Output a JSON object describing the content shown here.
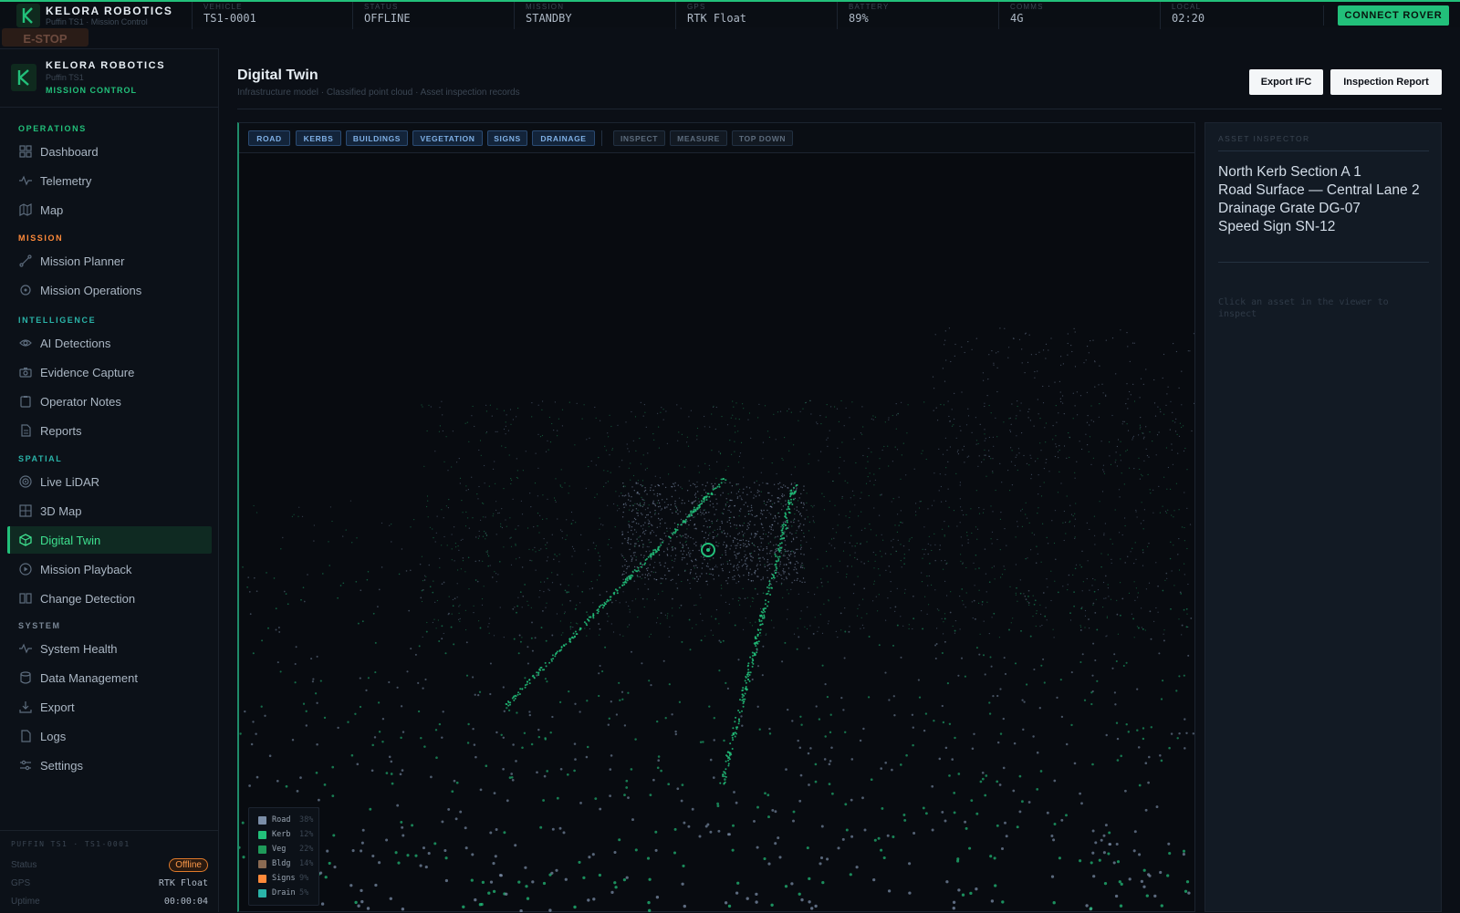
{
  "topbar": {
    "brand_title": "KELORA ROBOTICS",
    "brand_sub": "Puffin TS1 · Mission Control",
    "stats": [
      {
        "label": "VEHICLE",
        "value": "TS1-0001"
      },
      {
        "label": "STATUS",
        "value": "OFFLINE"
      },
      {
        "label": "MISSION",
        "value": "STANDBY"
      },
      {
        "label": "GPS",
        "value": "RTK Float"
      },
      {
        "label": "BATTERY",
        "value": "89%"
      },
      {
        "label": "COMMS",
        "value": "4G"
      },
      {
        "label": "LOCAL",
        "value": "02:20"
      }
    ],
    "connect_label": "CONNECT ROVER",
    "estop_label": "E-STOP"
  },
  "sidebar": {
    "brand_title": "KELORA ROBOTICS",
    "brand_model": "Puffin TS1",
    "brand_tag": "MISSION CONTROL",
    "sections": [
      {
        "label": "OPERATIONS",
        "color": "#22c07a"
      },
      {
        "label": "MISSION",
        "color": "#ff8a3a"
      },
      {
        "label": "INTELLIGENCE",
        "color": "#2ab3a8"
      },
      {
        "label": "SPATIAL",
        "color": "#2ab3a8"
      },
      {
        "label": "SYSTEM",
        "color": "#7a8796"
      }
    ],
    "items": [
      {
        "label": "Dashboard",
        "icon": "grid-icon"
      },
      {
        "label": "Telemetry",
        "icon": "pulse-icon"
      },
      {
        "label": "Map",
        "icon": "map-icon"
      },
      {
        "label": "Mission Planner",
        "icon": "route-icon"
      },
      {
        "label": "Mission Operations",
        "icon": "crosshair-icon"
      },
      {
        "label": "AI Detections",
        "icon": "eye-icon"
      },
      {
        "label": "Evidence Capture",
        "icon": "camera-icon"
      },
      {
        "label": "Operator Notes",
        "icon": "clipboard-icon"
      },
      {
        "label": "Reports",
        "icon": "document-icon"
      },
      {
        "label": "Live LiDAR",
        "icon": "lidar-icon"
      },
      {
        "label": "3D Map",
        "icon": "cube-grid-icon"
      },
      {
        "label": "Digital Twin",
        "icon": "cube-icon"
      },
      {
        "label": "Mission Playback",
        "icon": "play-icon"
      },
      {
        "label": "Change Detection",
        "icon": "compare-icon"
      },
      {
        "label": "System Health",
        "icon": "pulse-icon"
      },
      {
        "label": "Data Management",
        "icon": "database-icon"
      },
      {
        "label": "Export",
        "icon": "download-icon"
      },
      {
        "label": "Logs",
        "icon": "list-icon"
      },
      {
        "label": "Settings",
        "icon": "sliders-icon"
      }
    ],
    "active_item": "Digital Twin",
    "footer": {
      "title": "PUFFIN TS1 · TS1-0001",
      "rows": [
        {
          "key": "Status",
          "value": "Offline"
        },
        {
          "key": "GPS",
          "value": "RTK Float"
        },
        {
          "key": "Uptime",
          "value": "00:00:04"
        }
      ]
    }
  },
  "main": {
    "title": "Digital Twin",
    "subtitle": "Infrastructure model · Classified point cloud · Asset inspection records",
    "export_ifc_label": "Export IFC",
    "inspection_report_label": "Inspection Report"
  },
  "viewer": {
    "layer_chips": [
      "ROAD",
      "KERBS",
      "BUILDINGS",
      "VEGETATION",
      "SIGNS",
      "DRAINAGE"
    ],
    "tool_chips": [
      "INSPECT",
      "MEASURE",
      "TOP DOWN"
    ],
    "legend": [
      {
        "name": "Road",
        "pct": "38%",
        "color": "#7b8ea8"
      },
      {
        "name": "Kerb",
        "pct": "12%",
        "color": "#22c07a"
      },
      {
        "name": "Veg",
        "pct": "22%",
        "color": "#1f9a5a"
      },
      {
        "name": "Bldg",
        "pct": "14%",
        "color": "#8a6a52"
      },
      {
        "name": "Signs",
        "pct": "9%",
        "color": "#ff8a3a"
      },
      {
        "name": "Drain",
        "pct": "5%",
        "color": "#2ab3a8"
      }
    ]
  },
  "inspector": {
    "title": "ASSET INSPECTOR",
    "assets": [
      "North Kerb Section A 1",
      "Road Surface — Central Lane 2",
      "Drainage Grate DG-07",
      "Speed Sign SN-12"
    ],
    "hint": "Click an asset in the viewer to inspect"
  }
}
